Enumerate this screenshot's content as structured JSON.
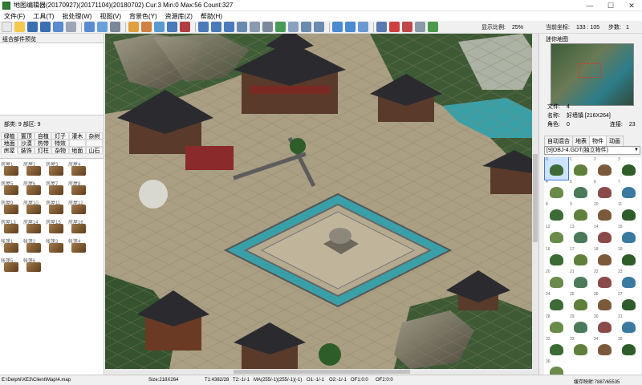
{
  "window": {
    "title": "地图编辑器(20170927)(20171104)(20180702)  Cur:3  Min:0  Max:56  Count:327"
  },
  "menu": [
    "文件(F)",
    "工具(T)",
    "批处理(W)",
    "视图(V)",
    "背景色(Y)",
    "资源库(Z)",
    "帮助(H)"
  ],
  "toolbar": {
    "zoom_label": "显示比例:",
    "zoom_value": "25%",
    "coord_label": "当前坐标:",
    "coord_value": "133 : 105",
    "step_label": "步数:",
    "step_value": "1"
  },
  "left_panel": {
    "preview_title": "组合部件预览",
    "counts": "部类: 9  部区: 9",
    "categories": [
      "绿植",
      "置顶",
      "自植",
      "灯子",
      "灌木",
      "杂树",
      "地面",
      "沙漠",
      "热带",
      "特效",
      "",
      "",
      "房屋",
      "装饰",
      "灯柱",
      "杂物",
      "地面",
      "山石"
    ],
    "active_category_index": 12,
    "objects": [
      "房屋1",
      "房屋2",
      "房屋3",
      "房屋4",
      "房屋5",
      "房屋6",
      "房屋7",
      "房屋8",
      "房屋9",
      "房屋10",
      "房屋11",
      "房屋12",
      "房屋13",
      "房屋14",
      "房屋15",
      "房屋16",
      "帐篷1",
      "帐篷2",
      "帐篷3",
      "帐篷4",
      "帐篷5",
      "帐篷6"
    ]
  },
  "right_panel": {
    "minimap_title": "迷你地图",
    "file_label": "文件:",
    "file_value": "4",
    "name_label": "名称:",
    "name_value": "好墙镇 [216X264]",
    "layer_label": "角色:",
    "layer_value": "0",
    "link_label": "连接:",
    "link_value": "23",
    "tabs": [
      "自动混合",
      "地表",
      "物件",
      "动画"
    ],
    "active_tab_index": 2,
    "object_set": "[9]OBJ-4.GDT(独立物件)",
    "items": [
      "9",
      "1",
      "2",
      "3",
      "4",
      "5",
      "6",
      "7",
      "8",
      "9",
      "10",
      "11",
      "12",
      "13",
      "14",
      "15",
      "16",
      "17",
      "18",
      "19",
      "20",
      "21",
      "22",
      "23",
      "24",
      "25",
      "26",
      "27",
      "28",
      "29",
      "30",
      "31",
      "32",
      "33",
      "34",
      "35",
      "36"
    ],
    "selected_item_index": 0
  },
  "status": {
    "path": "E:\\Delphi\\XE3\\Client\\Map\\4.map",
    "size": "Size:218X264",
    "t1": "T1:4382/28",
    "t2": "T2:-1/-1",
    "ma": "MA(255/-1)(255/-1)(-1)",
    "o1": "O1:-1/-1",
    "o2": "O2:-1/-1",
    "of1": "OF1:0:0",
    "of2": "OF2:0:0",
    "cache": "缓存映射:7887/65535"
  },
  "colors": {
    "tile_grid": "#8a8068",
    "water": "#3aa0a8",
    "roof": "#2b2b2f",
    "foliage": "#2f5d2a"
  }
}
